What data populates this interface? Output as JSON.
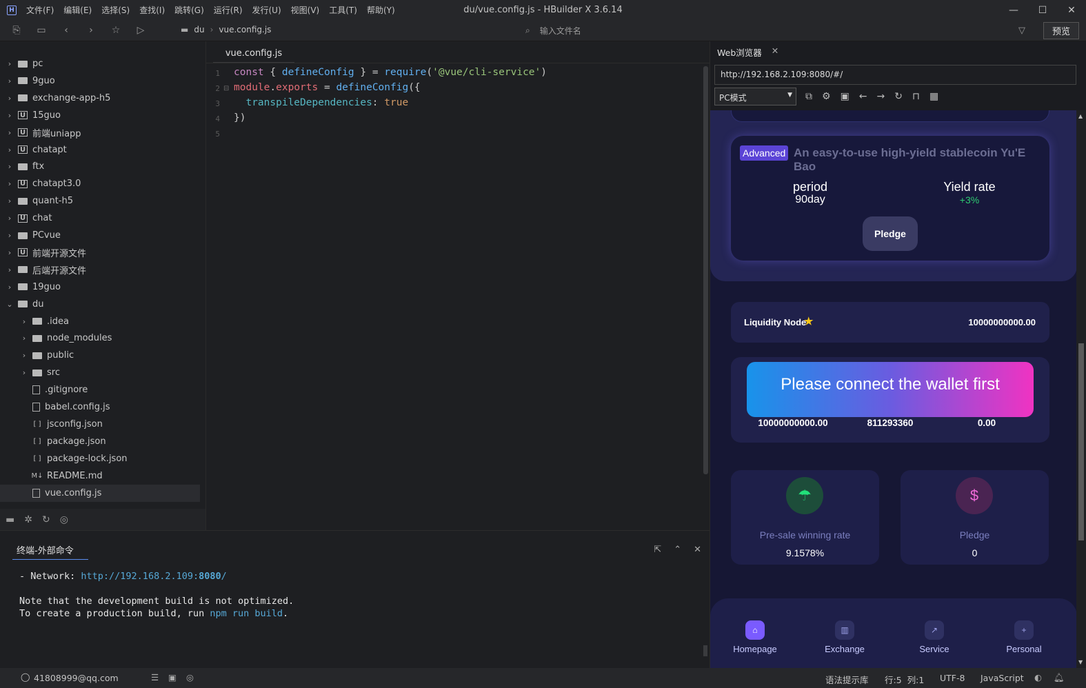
{
  "window": {
    "title": "du/vue.config.js - HBuilder X 3.6.14",
    "menu": [
      "文件(F)",
      "编辑(E)",
      "选择(S)",
      "查找(I)",
      "跳转(G)",
      "运行(R)",
      "发行(U)",
      "视图(V)",
      "工具(T)",
      "帮助(Y)"
    ],
    "controls": [
      "—",
      "☐",
      "✕"
    ]
  },
  "toolbar": {
    "breadcrumb": [
      "du",
      "vue.config.js"
    ],
    "file_search_placeholder": "输入文件名",
    "preview_label": "预览"
  },
  "project_tree": [
    {
      "label": "pc",
      "icon": "folder",
      "level": 0,
      "expanded": false
    },
    {
      "label": "9guo",
      "icon": "folder",
      "level": 0,
      "expanded": false
    },
    {
      "label": "exchange-app-h5",
      "icon": "folder",
      "level": 0,
      "expanded": false
    },
    {
      "label": "15guo",
      "icon": "uni",
      "level": 0,
      "expanded": false
    },
    {
      "label": "前端uniapp",
      "icon": "uni",
      "level": 0,
      "expanded": false
    },
    {
      "label": "chatapt",
      "icon": "uni",
      "level": 0,
      "expanded": false
    },
    {
      "label": "ftx",
      "icon": "folder",
      "level": 0,
      "expanded": false
    },
    {
      "label": "chatapt3.0",
      "icon": "uni",
      "level": 0,
      "expanded": false
    },
    {
      "label": "quant-h5",
      "icon": "folder",
      "level": 0,
      "expanded": false
    },
    {
      "label": "chat",
      "icon": "uni",
      "level": 0,
      "expanded": false
    },
    {
      "label": "PCvue",
      "icon": "folder",
      "level": 0,
      "expanded": false
    },
    {
      "label": "前端开源文件",
      "icon": "uni",
      "level": 0,
      "expanded": false
    },
    {
      "label": "后端开源文件",
      "icon": "folder",
      "level": 0,
      "expanded": false
    },
    {
      "label": "19guo",
      "icon": "folder",
      "level": 0,
      "expanded": false
    },
    {
      "label": "du",
      "icon": "folder",
      "level": 0,
      "expanded": true
    },
    {
      "label": ".idea",
      "icon": "folder",
      "level": 1,
      "expanded": false
    },
    {
      "label": "node_modules",
      "icon": "folder",
      "level": 1,
      "expanded": false
    },
    {
      "label": "public",
      "icon": "folder",
      "level": 1,
      "expanded": false
    },
    {
      "label": "src",
      "icon": "folder",
      "level": 1,
      "expanded": false
    },
    {
      "label": ".gitignore",
      "icon": "file",
      "level": 1
    },
    {
      "label": "babel.config.js",
      "icon": "js",
      "level": 1
    },
    {
      "label": "jsconfig.json",
      "icon": "json",
      "level": 1
    },
    {
      "label": "package.json",
      "icon": "json",
      "level": 1
    },
    {
      "label": "package-lock.json",
      "icon": "json",
      "level": 1
    },
    {
      "label": "README.md",
      "icon": "md",
      "level": 1
    },
    {
      "label": "vue.config.js",
      "icon": "js",
      "level": 1,
      "selected": true
    }
  ],
  "editor": {
    "tab_label": "vue.config.js",
    "line_numbers": [
      "1",
      "2",
      "3",
      "4",
      "5"
    ],
    "lines": [
      "const { defineConfig } = require('@vue/cli-service')",
      "module.exports = defineConfig({",
      "  transpileDependencies: true",
      "})",
      ""
    ]
  },
  "terminal": {
    "tab_label": "终端-外部命令",
    "network_prefix": "- Network: ",
    "network_url_a": "http://192.168.2.109:",
    "network_port": "8080",
    "network_url_b": "/",
    "note_line": "Note that the development build is not optimized.",
    "build_prefix": "To create a production build, run ",
    "build_cmd": "npm run build",
    "build_suffix": "."
  },
  "statusbar": {
    "account": "41808999@qq.com",
    "hint_lib": "语法提示库",
    "position": "行:5  列:1",
    "encoding": "UTF-8",
    "language": "JavaScript"
  },
  "browser": {
    "tab_label": "Web浏览器",
    "url": "http://192.168.2.109:8080/#/",
    "mode": "PC模式",
    "app": {
      "badge": "Advanced",
      "card_title": "An easy-to-use high-yield stablecoin Yu'E Bao",
      "period_label": "period",
      "period_value": "90day",
      "yield_label": "Yield rate",
      "yield_value": "+3%",
      "pledge_button": "Pledge",
      "node_label": "Liquidity Node",
      "node_value": "10000000000.00",
      "connect_button": "Please connect the wallet first",
      "connect_values": [
        "10000000000.00",
        "811293360",
        "0.00"
      ],
      "stat1_label": "Pre-sale winning rate",
      "stat1_value": "9.1578%",
      "stat2_label": "Pledge",
      "stat2_value": "0",
      "nav": [
        "Homepage",
        "Exchange",
        "Service",
        "Personal"
      ]
    }
  },
  "colors": {
    "accent": "#5b8ef0",
    "app_bg": "#161734",
    "positive": "#2ecc71",
    "gradient_start": "#1893ea",
    "gradient_end": "#f033c2"
  }
}
